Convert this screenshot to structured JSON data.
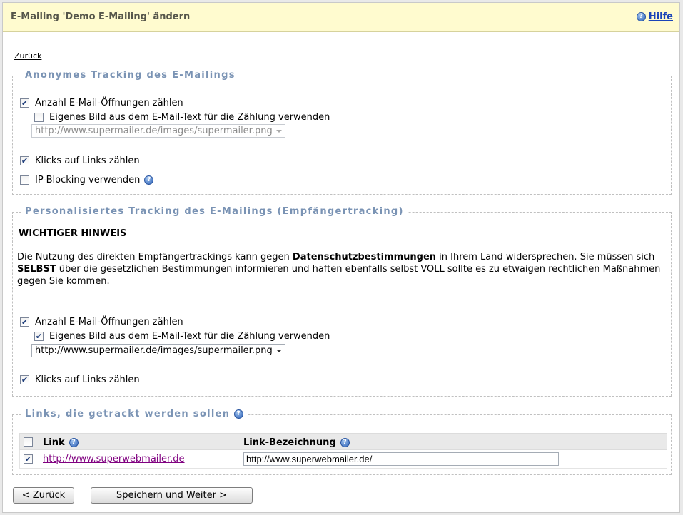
{
  "header": {
    "title": "E-Mailing 'Demo E-Mailing' ändern",
    "help_label": "Hilfe"
  },
  "nav": {
    "back_link": "Zurück"
  },
  "anonymous": {
    "legend": "Anonymes Tracking des E-Mailings",
    "count_opens": {
      "label": "Anzahl E-Mail-Öffnungen zählen",
      "checked": true
    },
    "own_image": {
      "label": "Eigenes Bild aus dem E-Mail-Text für die Zählung verwenden",
      "checked": false
    },
    "image_select": {
      "value": "http://www.supermailer.de/images/supermailer.png",
      "disabled": true
    },
    "count_clicks": {
      "label": "Klicks auf Links zählen",
      "checked": true
    },
    "ip_blocking": {
      "label": "IP-Blocking verwenden",
      "checked": false
    }
  },
  "personal": {
    "legend": "Personalisiertes Tracking des E-Mailings (Empfängertracking)",
    "notice_title": "WICHTIGER HINWEIS",
    "notice": {
      "part1": "Die Nutzung des direkten Empfängertrackings kann gegen ",
      "bold1": "Datenschutzbestimmungen",
      "part2": " in Ihrem Land widersprechen. Sie müssen sich ",
      "bold2": "SELBST",
      "part3": " über die gesetzlichen Bestimmungen informieren und haften ebenfalls selbst VOLL sollte es zu etwaigen rechtlichen Maßnahmen gegen Sie kommen."
    },
    "count_opens": {
      "label": "Anzahl E-Mail-Öffnungen zählen",
      "checked": true
    },
    "own_image": {
      "label": "Eigenes Bild aus dem E-Mail-Text für die Zählung verwenden",
      "checked": true
    },
    "image_select": {
      "value": "http://www.supermailer.de/images/supermailer.png",
      "disabled": false
    },
    "count_clicks": {
      "label": "Klicks auf Links zählen",
      "checked": true
    }
  },
  "links": {
    "legend": "Links, die getrackt werden sollen",
    "col_link": "Link",
    "col_name": "Link-Bezeichnung",
    "rows": [
      {
        "checked": true,
        "link": "http://www.superwebmailer.de",
        "name": "http://www.superwebmailer.de/"
      }
    ]
  },
  "buttons": {
    "back": "< Zurück",
    "save_next": "Speichern und Weiter >"
  },
  "colors": {
    "header_bg": "#fffbcf",
    "legend": "#7a93b4",
    "link_visited": "#800080",
    "help_link": "#1a44b8"
  }
}
